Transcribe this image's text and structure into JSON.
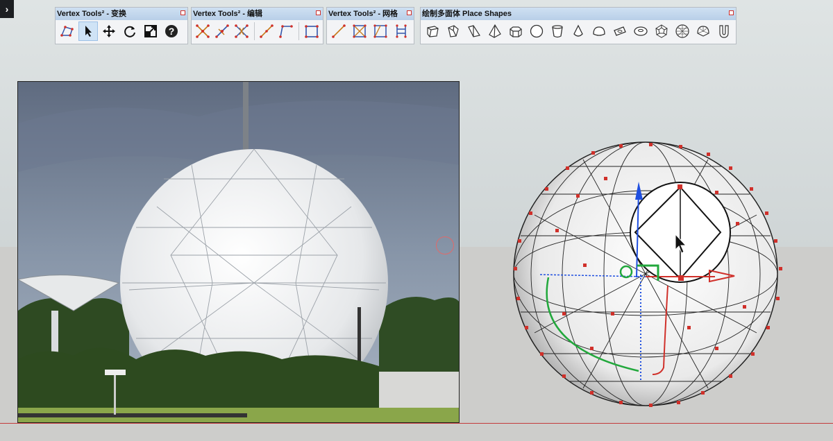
{
  "toolbars": [
    {
      "title": "Vertex Tools² - 变换",
      "buttons": [
        "select-polygon-icon",
        "pointer-icon",
        "move-icon",
        "rotate-icon",
        "scale-icon",
        "help-icon"
      ]
    },
    {
      "title": "Vertex Tools² - 编辑",
      "buttons": [
        "merge-vertices-icon",
        "split-edge-icon",
        "delete-vertex-icon",
        "line-icon",
        "polyline-icon",
        "box-icon"
      ]
    },
    {
      "title": "Vertex Tools² - 网格",
      "buttons": [
        "grid-line-icon",
        "grid-box-icon",
        "grid-frame-icon",
        "grid-ladder-icon"
      ]
    },
    {
      "title": "绘制多面体 Place Shapes",
      "buttons": [
        "cube-icon",
        "pentagon-prism-icon",
        "wedge-icon",
        "pyramid-icon",
        "hex-prism-icon",
        "sphere-icon",
        "cylinder-icon",
        "cone-icon",
        "hemisphere-icon",
        "torus-flat-icon",
        "torus-icon",
        "dodecahedron-icon",
        "geodesic-icon",
        "truncated-sphere-icon",
        "tube-icon"
      ]
    }
  ],
  "colors": {
    "accent_red": "#d0302a",
    "axis_blue": "#1f4fe0",
    "axis_green": "#22a83c",
    "toolbar_title_bg": "#c6daf0"
  }
}
